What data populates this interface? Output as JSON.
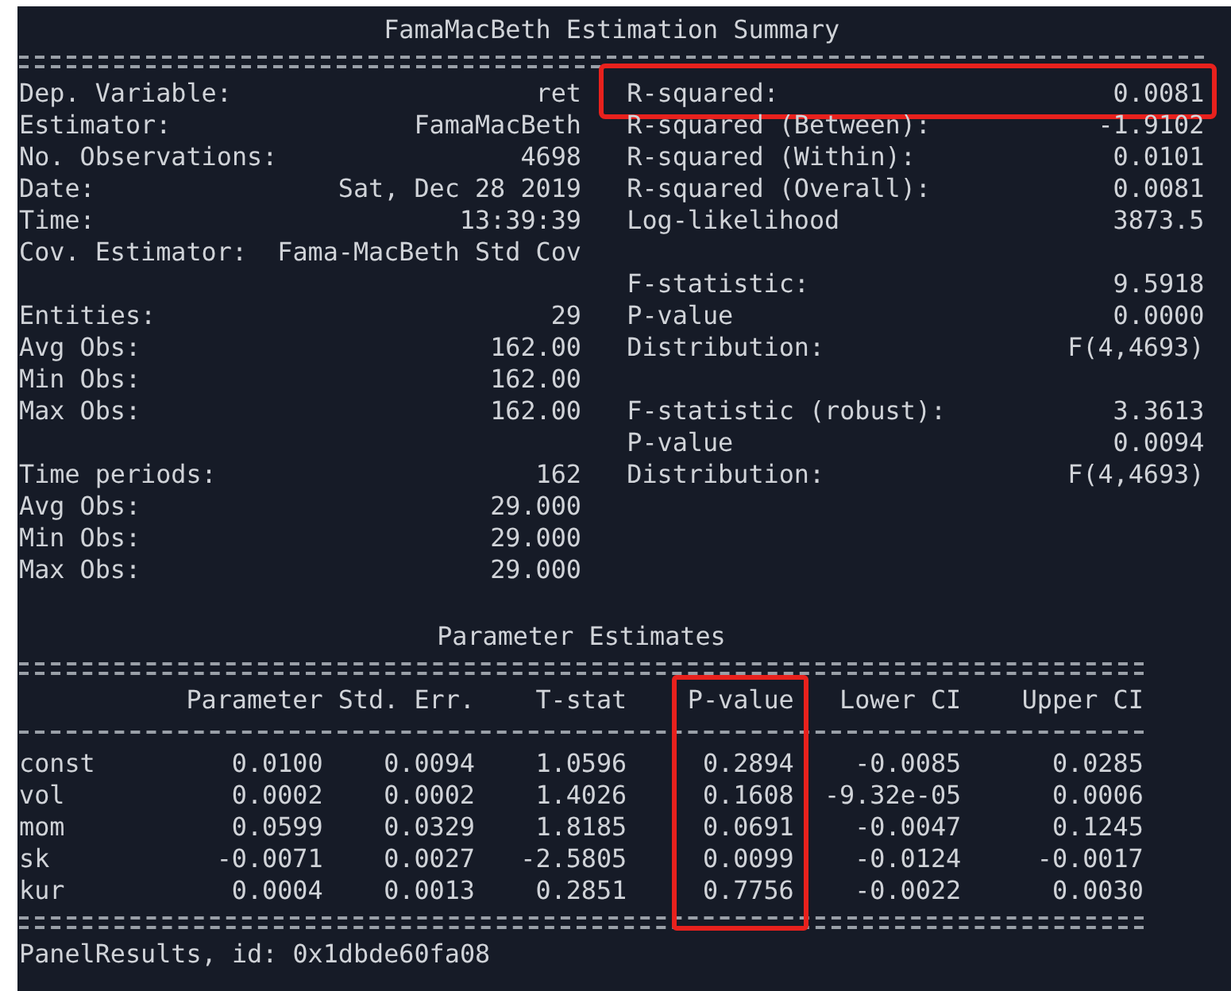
{
  "summary": {
    "title": "FamaMacBeth Estimation Summary",
    "left_groups": [
      [
        {
          "label": "Dep. Variable:",
          "value": "ret"
        },
        {
          "label": "Estimator:",
          "value": "FamaMacBeth"
        },
        {
          "label": "No. Observations:",
          "value": "4698"
        },
        {
          "label": "Date:",
          "value": "Sat, Dec 28 2019"
        },
        {
          "label": "Time:",
          "value": "13:39:39"
        },
        {
          "label": "Cov. Estimator:",
          "value": "Fama-MacBeth Std Cov"
        }
      ],
      [
        {
          "label": "Entities:",
          "value": "29"
        },
        {
          "label": "Avg Obs:",
          "value": "162.00"
        },
        {
          "label": "Min Obs:",
          "value": "162.00"
        },
        {
          "label": "Max Obs:",
          "value": "162.00"
        }
      ],
      [
        {
          "label": "Time periods:",
          "value": "162"
        },
        {
          "label": "Avg Obs:",
          "value": "29.000"
        },
        {
          "label": "Min Obs:",
          "value": "29.000"
        },
        {
          "label": "Max Obs:",
          "value": "29.000"
        }
      ]
    ],
    "right_groups": [
      [
        {
          "label": "R-squared:",
          "value": "0.0081",
          "highlighted": true
        },
        {
          "label": "R-squared (Between):",
          "value": "-1.9102",
          "highlighted": false
        },
        {
          "label": "R-squared (Within):",
          "value": "0.0101",
          "highlighted": false
        },
        {
          "label": "R-squared (Overall):",
          "value": "0.0081",
          "highlighted": false
        },
        {
          "label": "Log-likelihood",
          "value": "3873.5",
          "highlighted": false
        }
      ],
      [
        {
          "label": "F-statistic:",
          "value": "9.5918",
          "highlighted": false
        },
        {
          "label": "P-value",
          "value": "0.0000",
          "highlighted": false
        },
        {
          "label": "Distribution:",
          "value": "F(4,4693)",
          "highlighted": false
        }
      ],
      [
        {
          "label": "F-statistic (robust):",
          "value": "3.3613",
          "highlighted": false
        },
        {
          "label": "P-value",
          "value": "0.0094",
          "highlighted": false
        },
        {
          "label": "Distribution:",
          "value": "F(4,4693)",
          "highlighted": false
        }
      ]
    ]
  },
  "estimates": {
    "title": "Parameter Estimates",
    "columns": [
      {
        "label": "Parameter",
        "highlighted": false
      },
      {
        "label": "Std. Err.",
        "highlighted": false
      },
      {
        "label": "T-stat",
        "highlighted": false
      },
      {
        "label": "P-value",
        "highlighted": true
      },
      {
        "label": "Lower CI",
        "highlighted": false
      },
      {
        "label": "Upper CI",
        "highlighted": false
      }
    ],
    "rows": [
      {
        "name": "const",
        "values": [
          "0.0100",
          "0.0094",
          "1.0596",
          "0.2894",
          "-0.0085",
          "0.0285"
        ]
      },
      {
        "name": "vol",
        "values": [
          "0.0002",
          "0.0002",
          "1.4026",
          "0.1608",
          "-9.32e-05",
          "0.0006"
        ]
      },
      {
        "name": "mom",
        "values": [
          "0.0599",
          "0.0329",
          "1.8185",
          "0.0691",
          "-0.0047",
          "0.1245"
        ]
      },
      {
        "name": "sk",
        "values": [
          "-0.0071",
          "0.0027",
          "-2.5805",
          "0.0099",
          "-0.0124",
          "-0.0017"
        ]
      },
      {
        "name": "kur",
        "values": [
          "0.0004",
          "0.0013",
          "0.2851",
          "0.7756",
          "-0.0022",
          "0.0030"
        ]
      }
    ]
  },
  "footer": "PanelResults, id: 0x1dbde60fa08"
}
